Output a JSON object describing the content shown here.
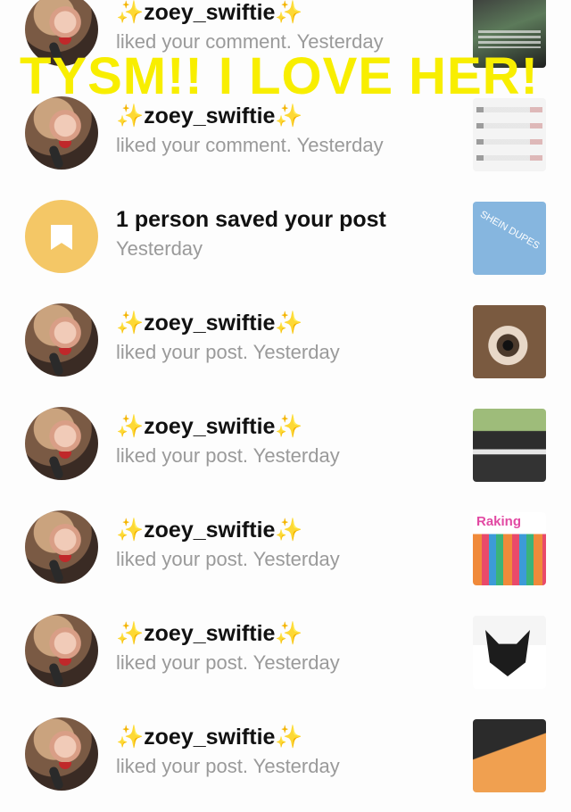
{
  "notifications": [
    {
      "user_prefix": "✨",
      "user": "zoey_swiftie",
      "user_suffix": "✨",
      "text": "liked your comment. Yesterday"
    },
    {
      "user_prefix": "✨",
      "user": "zoey_swiftie",
      "user_suffix": "✨",
      "text": "liked your comment. Yesterday"
    },
    {
      "title": "1 person saved your post",
      "text": "Yesterday",
      "thumb_label": "SHEIN DUPES"
    },
    {
      "user_prefix": "✨",
      "user": "zoey_swiftie",
      "user_suffix": "✨",
      "text": "liked your post. Yesterday"
    },
    {
      "user_prefix": "✨",
      "user": "zoey_swiftie",
      "user_suffix": "✨",
      "text": "liked your post. Yesterday"
    },
    {
      "user_prefix": "✨",
      "user": "zoey_swiftie",
      "user_suffix": "✨",
      "text": "liked your post. Yesterday",
      "thumb_label": "Raking"
    },
    {
      "user_prefix": "✨",
      "user": "zoey_swiftie",
      "user_suffix": "✨",
      "text": "liked your post. Yesterday"
    },
    {
      "user_prefix": "✨",
      "user": "zoey_swiftie",
      "user_suffix": "✨",
      "text": "liked your post. Yesterday"
    }
  ],
  "overlay_text": "TYSM!! I LOVE HER!",
  "colors": {
    "overlay": "#f8ee00",
    "save_circle": "#f4c766",
    "subtext": "#9a9a9a",
    "sparkle": "#f2c94c"
  }
}
